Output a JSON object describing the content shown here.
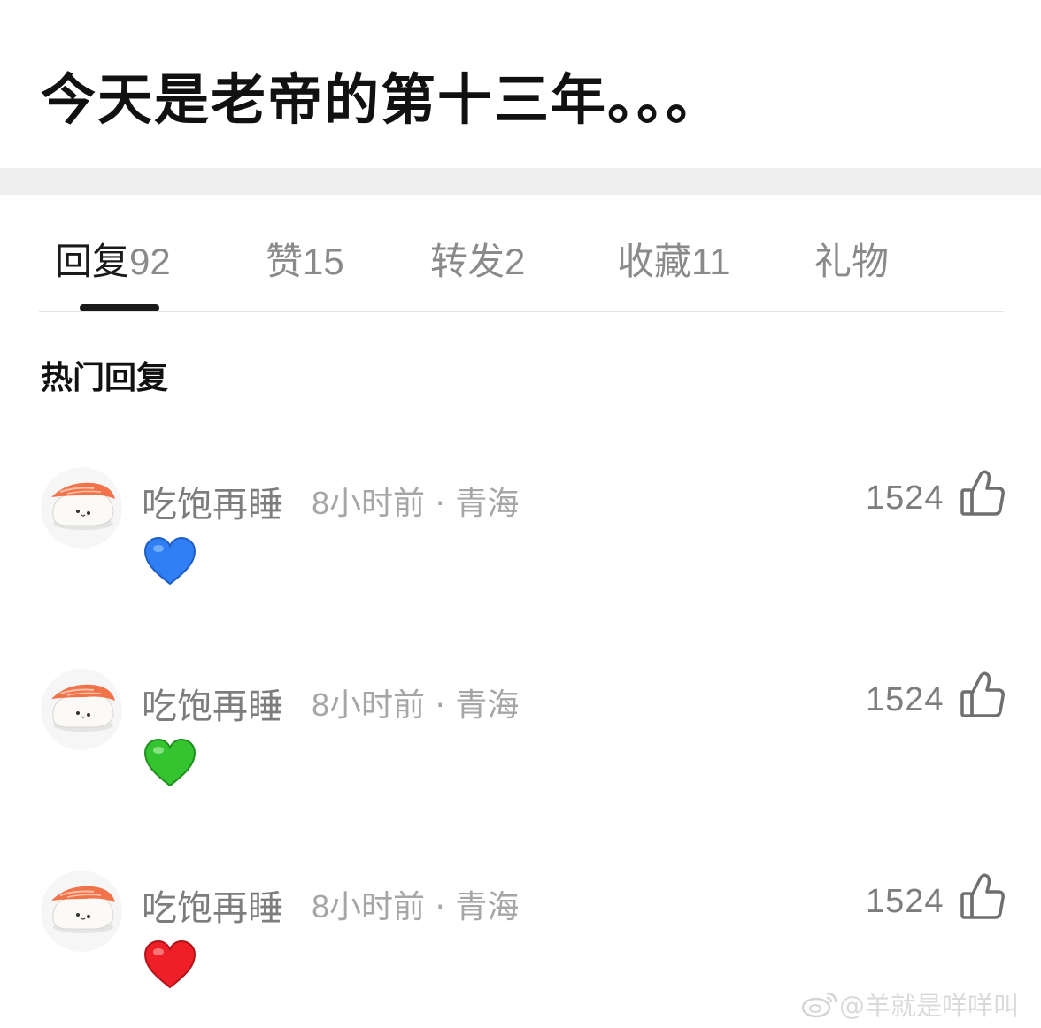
{
  "post": {
    "title": "今天是老帝的第十三年。。。"
  },
  "tabs": [
    {
      "label": "回复",
      "count": "92"
    },
    {
      "label": "赞",
      "count": "15"
    },
    {
      "label": "转发",
      "count": "2"
    },
    {
      "label": "收藏",
      "count": "11"
    },
    {
      "label": "礼物",
      "count": ""
    }
  ],
  "section": {
    "title": "热门回复"
  },
  "comments": [
    {
      "author": "吃饱再睡",
      "time": "8",
      "time_unit": "小时前",
      "separator": "·",
      "location": "青海",
      "likes": "1524",
      "emoji": "blue-heart",
      "emoji_color": "#2f7ef4"
    },
    {
      "author": "吃饱再睡",
      "time": "8",
      "time_unit": "小时前",
      "separator": "·",
      "location": "青海",
      "likes": "1524",
      "emoji": "green-heart",
      "emoji_color": "#34c42f"
    },
    {
      "author": "吃饱再睡",
      "time": "8",
      "time_unit": "小时前",
      "separator": "·",
      "location": "青海",
      "likes": "1524",
      "emoji": "red-heart",
      "emoji_color": "#ee1f26"
    }
  ],
  "watermark": {
    "text": "@羊就是咩咩叫"
  }
}
